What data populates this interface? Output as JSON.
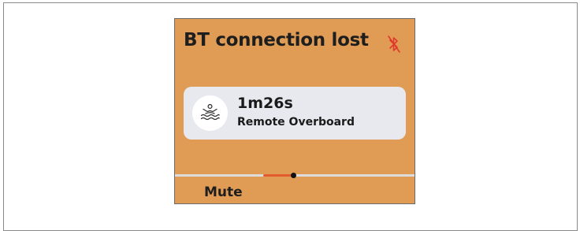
{
  "dialog": {
    "title": "BT connection lost",
    "status_icon": "bluetooth-disabled-icon",
    "status_icon_color": "#e0392b",
    "background_color": "#e09c55"
  },
  "alert": {
    "icon": "person-overboard-icon",
    "time": "1m26s",
    "label": "Remote Overboard",
    "card_color": "#e8e9ee"
  },
  "pager": {
    "active_color": "#e35a2f"
  },
  "actions": {
    "mute_label": "Mute"
  }
}
